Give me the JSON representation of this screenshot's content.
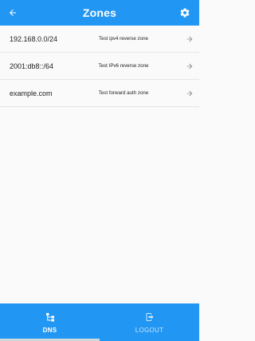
{
  "appbar": {
    "title": "Zones",
    "back_icon": "arrow-back-icon",
    "settings_icon": "gear-icon"
  },
  "zones": [
    {
      "name": "192.168.0.0/24",
      "description": "Test ipv4 reverse zone"
    },
    {
      "name": "2001:db8::/64",
      "description": "Test IPv6 reverse zone"
    },
    {
      "name": "example.com",
      "description": "Test forward auth zone"
    }
  ],
  "bottom_nav": {
    "items": [
      {
        "label": "DNS",
        "icon": "network-icon",
        "active": true
      },
      {
        "label": "LOGOUT",
        "icon": "logout-icon",
        "active": false
      }
    ]
  },
  "colors": {
    "primary": "#2196f3",
    "background": "#fafafa"
  }
}
